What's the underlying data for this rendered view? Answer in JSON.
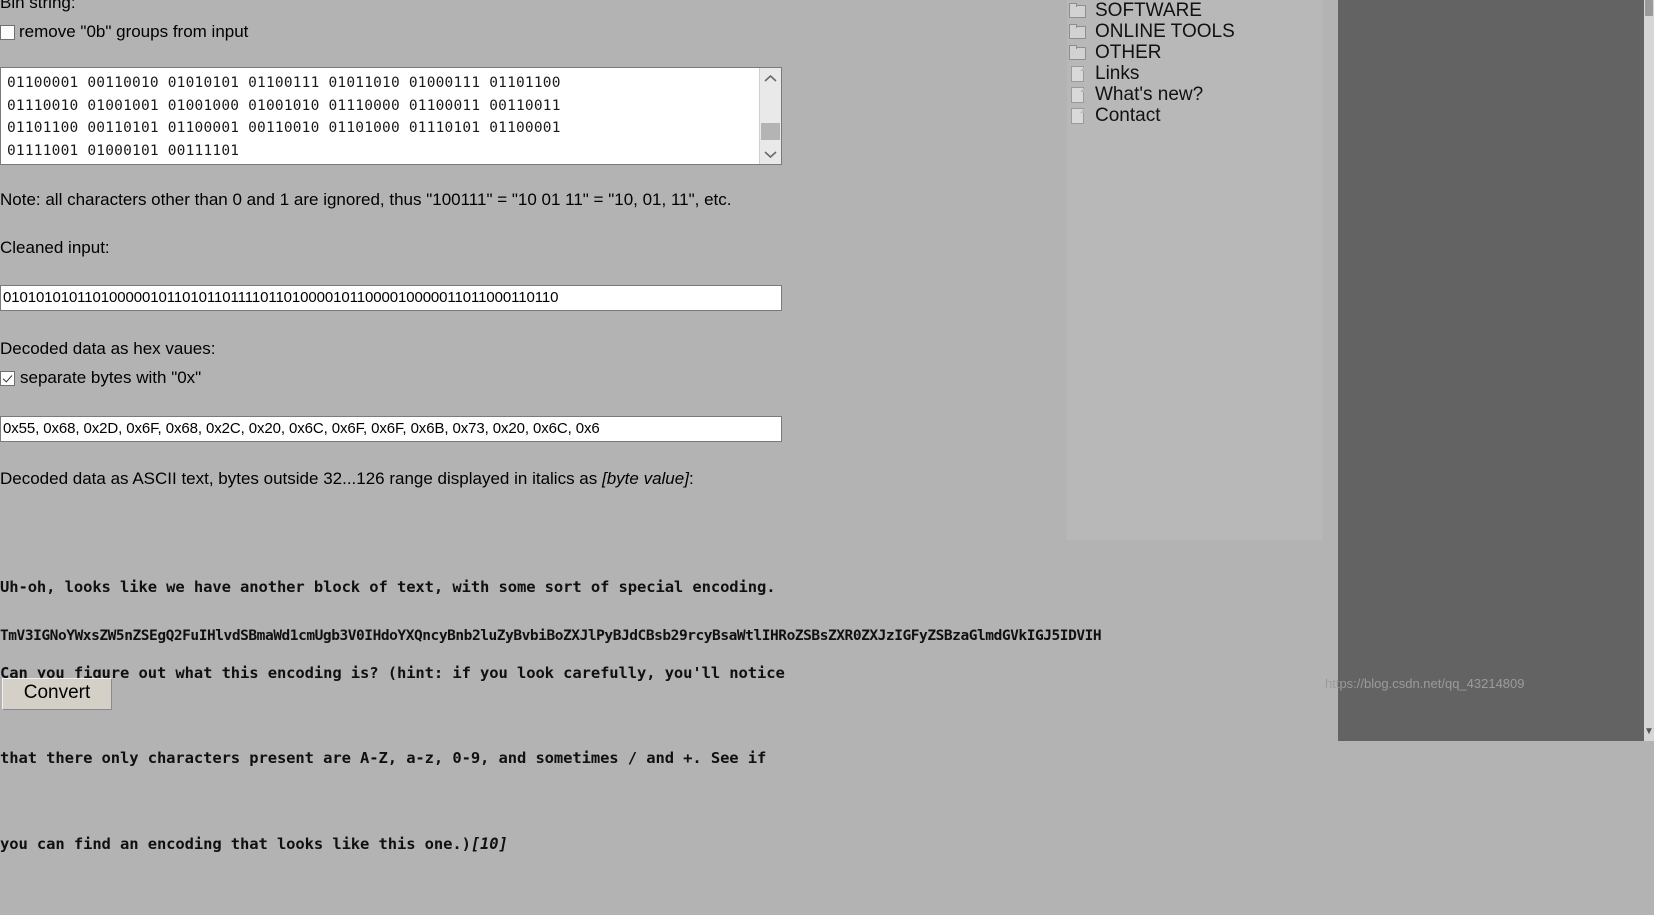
{
  "form": {
    "bin_string_label": "Bin string:",
    "remove_0b_label": "remove \"0b\" groups from input",
    "remove_0b_checked": false,
    "bin_textarea_value": "01100001 00110010 01010101 01100111 01011010 01000111 01101100\n01110010 01001001 01001000 01001010 01110000 01100011 00110011\n01101100 00110101 01100001 00110010 01101000 01110101 01100001\n01111001 01000101 00111101",
    "note_text": "Note: all characters other than 0 and 1 are ignored, thus \"100111\" = \"10 01 11\" = \"10, 01, 11\", etc.",
    "cleaned_input_label": "Cleaned input:",
    "cleaned_input_value": "010101010110100000101101011011110110100001011000010000011011000110110",
    "hex_label": "Decoded data as hex vaues:",
    "separate_0x_label": "separate bytes with \"0x\"",
    "separate_0x_checked": true,
    "hex_input_value": "0x55, 0x68, 0x2D, 0x6F, 0x68, 0x2C, 0x20, 0x6C, 0x6F, 0x6F, 0x6B, 0x73, 0x20, 0x6C, 0x6",
    "ascii_label_before": "Decoded data as ASCII text, bytes outside 32...126 range displayed in italics as ",
    "ascii_label_italic": "[byte value]",
    "ascii_label_after": ":",
    "ascii_line_1": "Uh-oh, looks like we have another block of text, with some sort of special encoding.",
    "ascii_line_2": "Can you figure out what this encoding is? (hint: if you look carefully, you'll notice",
    "ascii_line_3": "that there only characters present are A-Z, a-z, 0-9, and sometimes / and +. See if",
    "ascii_line_4_text": "you can find an encoding that looks like this one.)",
    "ascii_line_4_italic": "[10]",
    "base64_line": "TmV3IGNoYWxsZW5nZSEgQ2FuIHlvdSBmaWd1cmUgb3V0IHdoYXQncyBnb2luZyBvbiBoZXJlPyBJdCBsb29rcyBsaWtlIHRoZSBsZXR0ZXJzIGFyZSBzaGlmdGVkIGJ5IDVIH",
    "convert_label": "Convert"
  },
  "sidebar": {
    "items": [
      {
        "label": "SOFTWARE",
        "icon": "folder-icon"
      },
      {
        "label": "ONLINE TOOLS",
        "icon": "folder-icon"
      },
      {
        "label": "OTHER",
        "icon": "folder-icon"
      },
      {
        "label": "Links",
        "icon": "page-icon"
      },
      {
        "label": "What's new?",
        "icon": "page-icon"
      },
      {
        "label": "Contact",
        "icon": "page-icon"
      }
    ]
  },
  "watermark": {
    "text": "https://blog.csdn.net/qq_43214809"
  },
  "colors": {
    "page_background": "#b3b3b3",
    "gutter": "#636363",
    "field_background": "#ffffff",
    "sidebar_background": "#b8b8b8"
  }
}
